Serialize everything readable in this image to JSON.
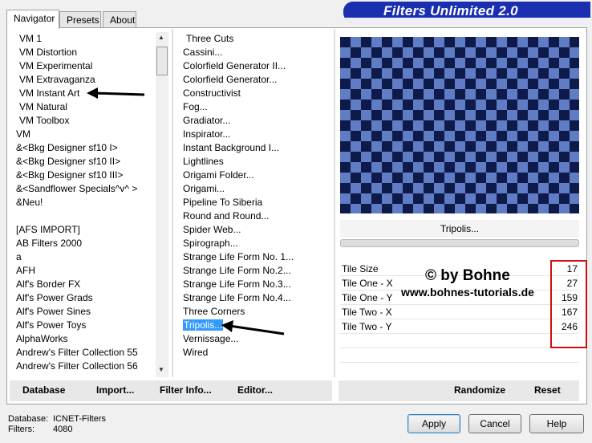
{
  "tabs": [
    "Navigator",
    "Presets",
    "About"
  ],
  "title": "Filters Unlimited 2.0",
  "categories": [
    "VM 1",
    "VM Distortion",
    "VM Experimental",
    "VM Extravaganza",
    "VM Instant Art",
    "VM Natural",
    "VM Toolbox",
    "VM",
    "&<Bkg Designer sf10 I>",
    "&<Bkg Designer sf10 II>",
    "&<Bkg Designer sf10 III>",
    "&<Sandflower Specials^v^ >",
    "&Neu!",
    "",
    "[AFS IMPORT]",
    "AB Filters 2000",
    "a",
    "AFH",
    "Alf's Border FX",
    "Alf's Power Grads",
    "Alf's Power Sines",
    "Alf's Power Toys",
    "AlphaWorks",
    "Andrew's Filter Collection 55",
    "Andrew's Filter Collection 56"
  ],
  "filters": [
    "Three Cuts",
    "Cassini...",
    "Colorfield Generator II...",
    "Colorfield Generator...",
    "Constructivist",
    "Fog...",
    "Gradiator...",
    "Inspirator...",
    "Instant Background I...",
    "Lightlines",
    "Origami Folder...",
    "Origami...",
    "Pipeline To Siberia",
    "Round and Round...",
    "Spider Web...",
    "Spirograph...",
    "Strange Life Form No. 1...",
    "Strange Life Form No.2...",
    "Strange Life Form No.3...",
    "Strange Life Form No.4...",
    "Three Corners",
    "Tripolis...",
    "Vernissage...",
    "Wired"
  ],
  "selected_filter_index": 21,
  "selected_filter_name": "Tripolis...",
  "params": [
    {
      "label": "Tile Size",
      "value": "17"
    },
    {
      "label": "Tile One - X",
      "value": "27"
    },
    {
      "label": "Tile One - Y",
      "value": "159"
    },
    {
      "label": "Tile Two - X",
      "value": "167"
    },
    {
      "label": "Tile Two - Y",
      "value": "246"
    }
  ],
  "watermark": {
    "line1": "© by Bohne",
    "line2": "www.bohnes-tutorials.de"
  },
  "left_buttons": {
    "database": "Database",
    "import": "Import...",
    "filter_info": "Filter Info...",
    "editor": "Editor..."
  },
  "right_buttons": {
    "randomize": "Randomize",
    "reset": "Reset"
  },
  "dialog_buttons": {
    "apply": "Apply",
    "cancel": "Cancel",
    "help": "Help"
  },
  "status": {
    "database_label": "Database:",
    "database_value": "ICNET-Filters",
    "filters_label": "Filters:",
    "filters_value": "4080"
  },
  "colors": {
    "banner": "#1a2eb0",
    "selection": "#3399ff",
    "highlight_box": "#d01010"
  }
}
